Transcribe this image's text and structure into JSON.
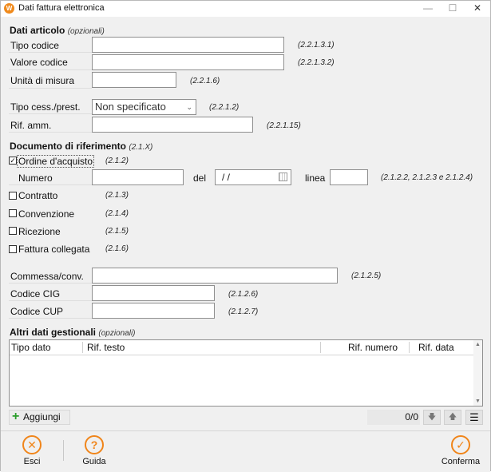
{
  "window": {
    "title": "Dati fattura elettronica",
    "app_icon": "app-logo-icon",
    "controls": {
      "minimize": "—",
      "maximize": "☐",
      "close": "✕"
    }
  },
  "articolo": {
    "title": "Dati articolo",
    "optional": "(opzionali)",
    "tipo_codice": {
      "label": "Tipo codice",
      "value": "",
      "code": "(2.2.1.3.1)"
    },
    "valore_codice": {
      "label": "Valore codice",
      "value": "",
      "code": "(2.2.1.3.2)"
    },
    "unita_misura": {
      "label": "Unità di misura",
      "value": "",
      "code": "(2.2.1.6)"
    },
    "tipo_cess": {
      "label": "Tipo cess./prest.",
      "selected": "Non specificato",
      "code": "(2.2.1.2)"
    },
    "rif_amm": {
      "label": "Rif. amm.",
      "value": "",
      "code": "(2.2.1.15)"
    }
  },
  "documento": {
    "title": "Documento di riferimento",
    "code": "(2.1.X)",
    "ordine": {
      "label": "Ordine d'acquisto",
      "checked": true,
      "check_glyph": "✓",
      "code": "(2.1.2)"
    },
    "numero": {
      "label": "Numero",
      "value": ""
    },
    "del": {
      "label": "del",
      "value": "/  /"
    },
    "linea": {
      "label": "linea",
      "value": "",
      "code": "(2.1.2.2, 2.1.2.3 e 2.1.2.4)"
    },
    "contratto": {
      "label": "Contratto",
      "checked": false,
      "code": "(2.1.3)"
    },
    "convenzione": {
      "label": "Convenzione",
      "checked": false,
      "code": "(2.1.4)"
    },
    "ricezione": {
      "label": "Ricezione",
      "checked": false,
      "code": "(2.1.5)"
    },
    "fattura_collegata": {
      "label": "Fattura collegata",
      "checked": false,
      "code": "(2.1.6)"
    }
  },
  "commessa": {
    "label": "Commessa/conv.",
    "value": "",
    "code": "(2.1.2.5)"
  },
  "cig": {
    "label": "Codice CIG",
    "value": "",
    "code": "(2.1.2.6)"
  },
  "cup": {
    "label": "Codice CUP",
    "value": "",
    "code": "(2.1.2.7)"
  },
  "gestionali": {
    "title": "Altri dati gestionali",
    "optional": "(opzionali)",
    "columns": [
      "Tipo dato",
      "Rif. testo",
      "Rif. numero",
      "Rif. data"
    ],
    "rows": [],
    "add_label": "Aggiungi",
    "counter": "0/0"
  },
  "footer": {
    "esci": {
      "label": "Esci",
      "icon": "close-circle-icon"
    },
    "guida": {
      "label": "Guida",
      "icon": "help-circle-icon"
    },
    "conferma": {
      "label": "Conferma",
      "icon": "check-circle-icon"
    }
  },
  "colors": {
    "accent": "#f0851a",
    "add_green": "#2a9d2a",
    "background": "#f0f0f0"
  }
}
